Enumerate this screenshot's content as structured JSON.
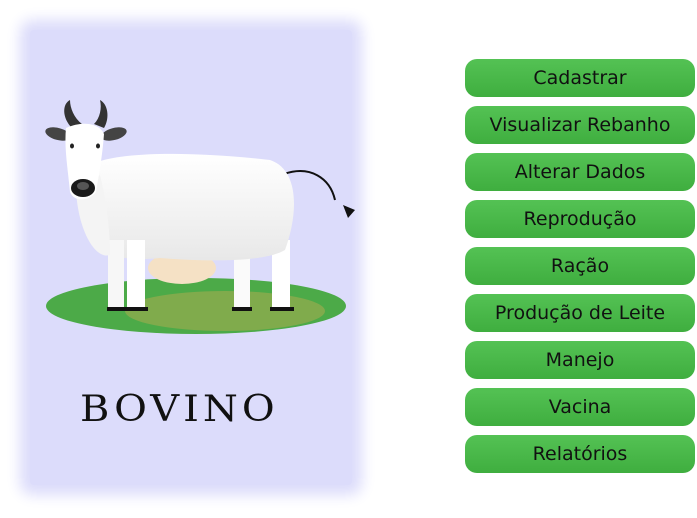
{
  "brand": {
    "title": "BOVINO"
  },
  "colors": {
    "panel_bg": "#dcdcfb",
    "button_green": "#4cbc4c",
    "grass_dark": "#4caa48",
    "grass_light": "#7fb04a"
  },
  "menu": {
    "items": [
      {
        "label": "Cadastrar"
      },
      {
        "label": "Visualizar Rebanho"
      },
      {
        "label": "Alterar Dados"
      },
      {
        "label": "Reprodução"
      },
      {
        "label": "Ração"
      },
      {
        "label": "Produção de Leite"
      },
      {
        "label": "Manejo"
      },
      {
        "label": "Vacina"
      },
      {
        "label": "Relatórios"
      }
    ]
  }
}
